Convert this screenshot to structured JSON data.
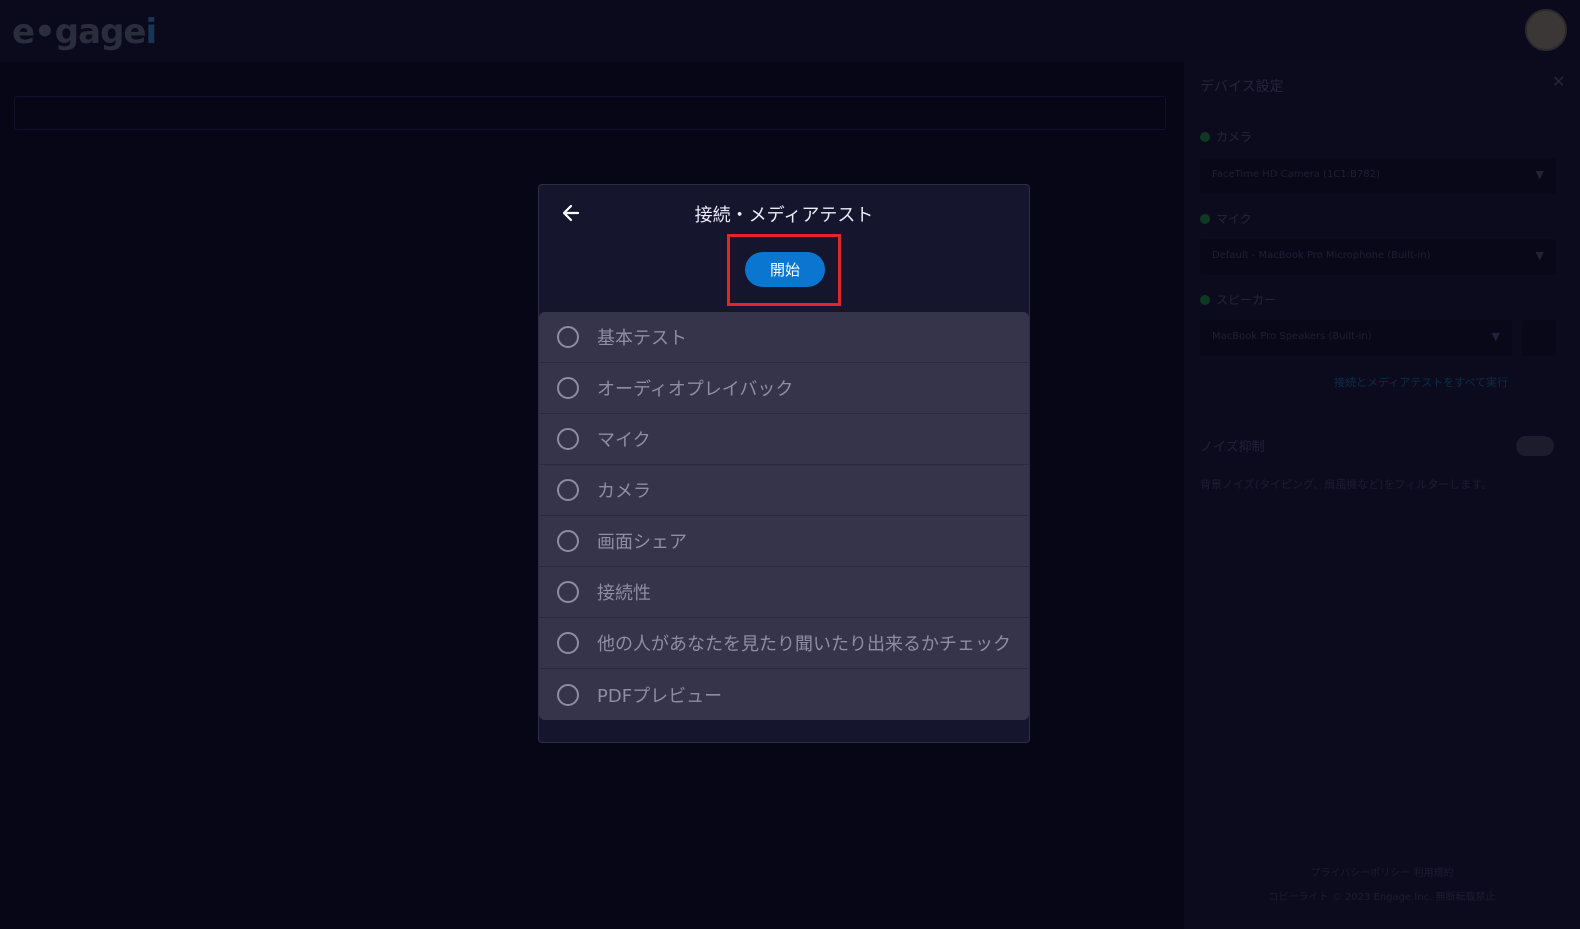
{
  "topbar": {
    "logo_main": "e•gage",
    "logo_accent": "i"
  },
  "settings_panel": {
    "title": "デバイス設定",
    "close": "✕",
    "camera_label": "カメラ",
    "camera_value": "FaceTime HD Camera (1C1:B782)",
    "mic_label": "マイク",
    "mic_value": "Default - MacBook Pro Microphone (Built-in)",
    "speaker_label": "スピーカー",
    "speaker_value": "MacBook Pro Speakers (Built-in)",
    "link": "接続とメディアテストをすべて実行",
    "noise_label": "ノイズ抑制",
    "noise_desc": "背景ノイズ(タイピング、扇風機など)をフィルターします。",
    "footer_line1": "プライバシーポリシー 利用規約",
    "footer_line2": "コピーライト © 2023 Engage Inc. 無断転載禁止"
  },
  "modal": {
    "title": "接続・メディアテスト",
    "start_label": "開始",
    "tests": [
      {
        "label": "基本テスト"
      },
      {
        "label": "オーディオプレイバック"
      },
      {
        "label": "マイク"
      },
      {
        "label": "カメラ"
      },
      {
        "label": "画面シェア"
      },
      {
        "label": "接続性"
      },
      {
        "label": "他の人があなたを見たり聞いたり出来るかチェック"
      },
      {
        "label": "PDFプレビュー"
      }
    ]
  },
  "icons": {
    "back": "arrow-left-icon",
    "radio": "radio-empty-icon"
  },
  "colors": {
    "accent": "#0b76d0",
    "highlight": "#e0262b",
    "modal_bg": "#16152e",
    "list_bg": "#35344a"
  }
}
